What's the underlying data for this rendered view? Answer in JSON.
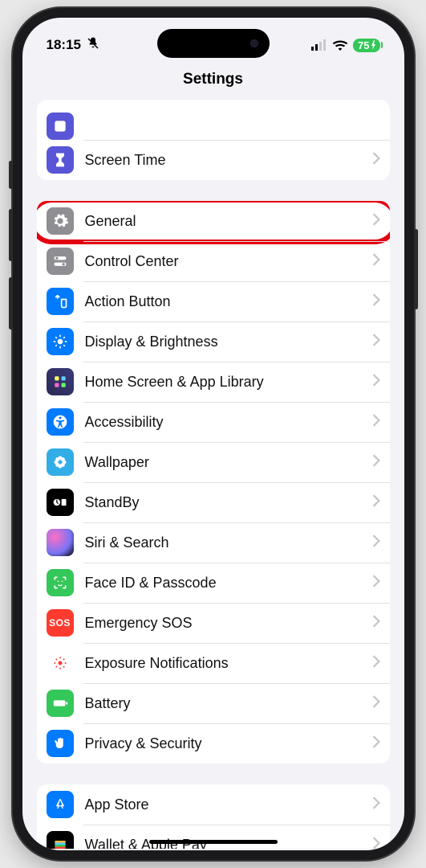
{
  "status": {
    "time": "18:15",
    "battery": "75",
    "silent": true
  },
  "header": {
    "title": "Settings"
  },
  "groups": [
    {
      "peek": {
        "label": "",
        "icon": "focus-icon",
        "bg": "bg-purple"
      },
      "items": [
        {
          "label": "Screen Time",
          "icon": "hourglass-icon",
          "bg": "bg-purple"
        }
      ]
    },
    {
      "items": [
        {
          "label": "General",
          "icon": "gear-icon",
          "bg": "bg-gray",
          "highlight": true
        },
        {
          "label": "Control Center",
          "icon": "switches-icon",
          "bg": "bg-gray"
        },
        {
          "label": "Action Button",
          "icon": "action-icon",
          "bg": "bg-blue"
        },
        {
          "label": "Display & Brightness",
          "icon": "sun-icon",
          "bg": "bg-blue"
        },
        {
          "label": "Home Screen & App Library",
          "icon": "apps-grid-icon",
          "bg": "bg-grid"
        },
        {
          "label": "Accessibility",
          "icon": "accessibility-icon",
          "bg": "bg-blue"
        },
        {
          "label": "Wallpaper",
          "icon": "flower-icon",
          "bg": "bg-cyan"
        },
        {
          "label": "StandBy",
          "icon": "standby-icon",
          "bg": "bg-black"
        },
        {
          "label": "Siri & Search",
          "icon": "siri-icon",
          "bg": "bg-siri"
        },
        {
          "label": "Face ID & Passcode",
          "icon": "faceid-icon",
          "bg": "bg-green"
        },
        {
          "label": "Emergency SOS",
          "icon": "sos-icon",
          "bg": "bg-red"
        },
        {
          "label": "Exposure Notifications",
          "icon": "exposure-icon",
          "bg": "bg-white"
        },
        {
          "label": "Battery",
          "icon": "battery-icon",
          "bg": "bg-green"
        },
        {
          "label": "Privacy & Security",
          "icon": "hand-icon",
          "bg": "bg-blue"
        }
      ]
    },
    {
      "items": [
        {
          "label": "App Store",
          "icon": "appstore-icon",
          "bg": "bg-blue"
        },
        {
          "label": "Wallet & Apple Pay",
          "icon": "wallet-icon",
          "bg": "bg-black"
        }
      ]
    }
  ]
}
